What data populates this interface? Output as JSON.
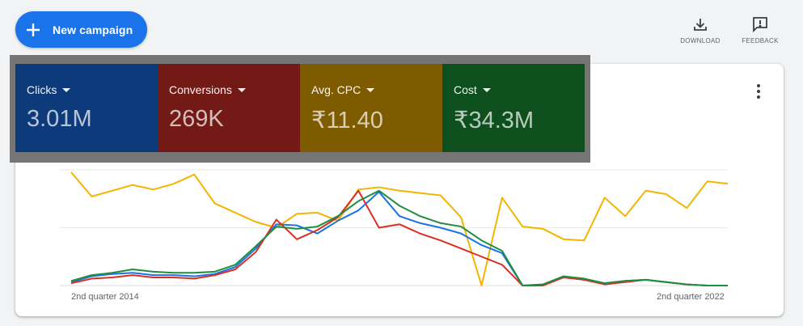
{
  "toolbar": {
    "new_campaign": "New campaign",
    "download": "DOWNLOAD",
    "feedback": "FEEDBACK"
  },
  "icons": {
    "new_campaign": "plus-icon",
    "download": "download-icon",
    "feedback": "feedback-icon",
    "menu": "more-vert-icon"
  },
  "metrics": [
    {
      "name": "Clicks",
      "value": "3.01M",
      "color": "#0d3a7a"
    },
    {
      "name": "Conversions",
      "value": "269K",
      "color": "#731a16"
    },
    {
      "name": "Avg. CPC",
      "value": "₹11.40",
      "color": "#7f5b00"
    },
    {
      "name": "Cost",
      "value": "₹34.3M",
      "color": "#0d4f1d"
    }
  ],
  "chart_data": {
    "type": "line",
    "x_tick_labels": [
      "2nd quarter 2014",
      "2nd quarter 2022"
    ],
    "x": [
      "2014 Q2",
      "2014 Q3",
      "2014 Q4",
      "2015 Q1",
      "2015 Q2",
      "2015 Q3",
      "2015 Q4",
      "2016 Q1",
      "2016 Q2",
      "2016 Q3",
      "2016 Q4",
      "2017 Q1",
      "2017 Q2",
      "2017 Q3",
      "2017 Q4",
      "2018 Q1",
      "2018 Q2",
      "2018 Q3",
      "2018 Q4",
      "2019 Q1",
      "2019 Q2",
      "2019 Q3",
      "2019 Q4",
      "2020 Q1",
      "2020 Q2",
      "2020 Q3",
      "2020 Q4",
      "2021 Q1",
      "2021 Q2",
      "2021 Q3",
      "2021 Q4",
      "2022 Q1",
      "2022 Q2"
    ],
    "grid": true,
    "ylim": [
      0,
      100
    ],
    "series": [
      {
        "color": "#f4b400",
        "values": [
          98,
          77,
          82,
          87,
          83,
          88,
          96,
          71,
          63,
          55,
          50,
          62,
          63,
          56,
          83,
          85,
          82,
          80,
          78,
          59,
          0,
          76,
          51,
          49,
          40,
          39,
          76,
          60,
          82,
          79,
          67,
          90,
          88
        ]
      },
      {
        "color": "#1a73e8",
        "values": [
          3,
          8,
          10,
          11,
          9,
          9,
          8,
          10,
          16,
          32,
          53,
          52,
          45,
          56,
          65,
          81,
          60,
          54,
          50,
          45,
          35,
          28,
          0,
          1,
          8,
          5,
          2,
          4,
          5,
          3,
          1,
          0,
          0
        ]
      },
      {
        "color": "#d93025",
        "values": [
          2,
          6,
          7,
          9,
          7,
          7,
          6,
          9,
          14,
          29,
          57,
          40,
          48,
          59,
          82,
          50,
          53,
          45,
          39,
          32,
          25,
          18,
          0,
          0,
          7,
          5,
          1,
          3,
          5,
          3,
          1,
          0,
          0
        ]
      },
      {
        "color": "#1e8e3e",
        "values": [
          4,
          9,
          11,
          14,
          12,
          11,
          11,
          12,
          18,
          34,
          51,
          49,
          51,
          60,
          73,
          82,
          69,
          60,
          54,
          51,
          39,
          30,
          0,
          1,
          8,
          6,
          2,
          4,
          5,
          3,
          1,
          0,
          0
        ]
      }
    ]
  }
}
